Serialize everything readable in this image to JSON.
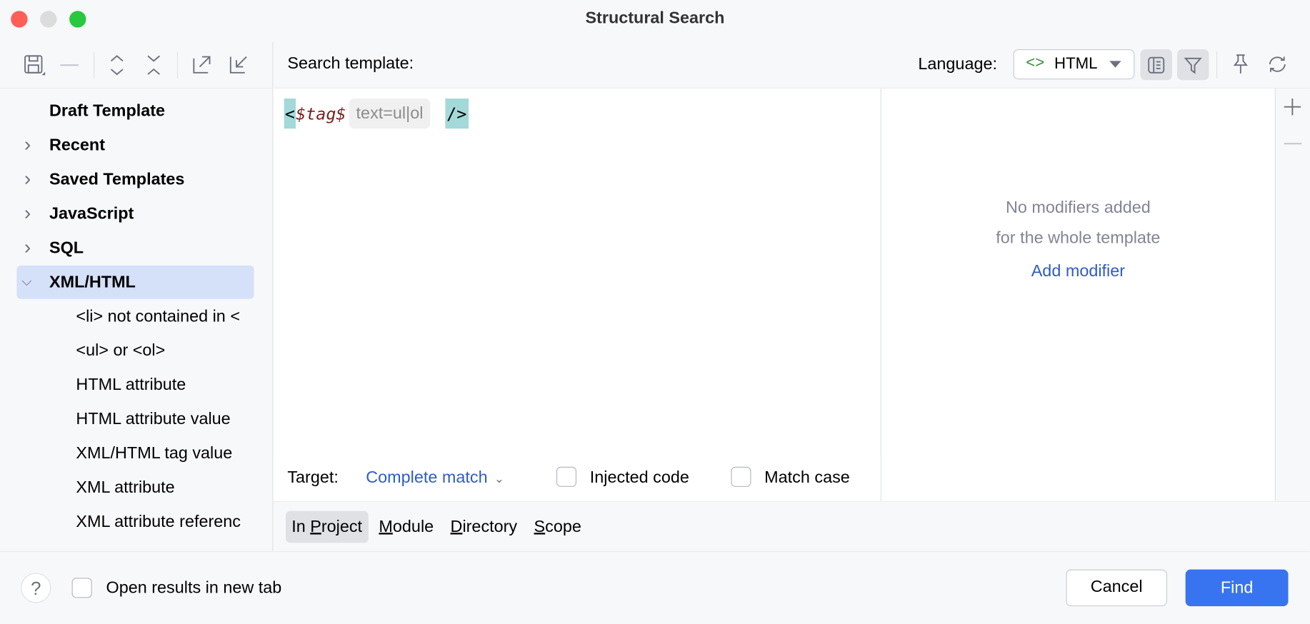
{
  "window": {
    "title": "Structural Search"
  },
  "sidebar": {
    "toolbar_icons": [
      "save-icon",
      "remove-icon",
      "expand-all-icon",
      "collapse-all-icon",
      "export-icon",
      "import-icon"
    ],
    "items": [
      {
        "label": "Draft Template",
        "level": 0,
        "expandable": false
      },
      {
        "label": "Recent",
        "level": 0,
        "expandable": true,
        "expanded": false
      },
      {
        "label": "Saved Templates",
        "level": 0,
        "expandable": true,
        "expanded": false
      },
      {
        "label": "JavaScript",
        "level": 0,
        "expandable": true,
        "expanded": false
      },
      {
        "label": "SQL",
        "level": 0,
        "expandable": true,
        "expanded": false
      },
      {
        "label": "XML/HTML",
        "level": 0,
        "expandable": true,
        "expanded": true,
        "selected": true
      },
      {
        "label": "<li> not contained in <",
        "level": 1
      },
      {
        "label": "<ul> or <ol>",
        "level": 1
      },
      {
        "label": "HTML attribute",
        "level": 1
      },
      {
        "label": "HTML attribute value",
        "level": 1
      },
      {
        "label": "XML/HTML tag value",
        "level": 1
      },
      {
        "label": "XML attribute",
        "level": 1
      },
      {
        "label": "XML attribute referenc",
        "level": 1
      }
    ]
  },
  "header": {
    "search_template_label": "Search template:",
    "language_label": "Language:",
    "language_value": "HTML"
  },
  "editor": {
    "open": "<",
    "variable": "$tag$",
    "inlay_hint": "text=ul|ol",
    "close": "/>"
  },
  "modifiers": {
    "empty_line1": "No modifiers added",
    "empty_line2": "for the whole template",
    "add_link": "Add modifier"
  },
  "options": {
    "target_label": "Target:",
    "target_value": "Complete match",
    "injected_code_label": "Injected code",
    "injected_code_checked": false,
    "match_case_label": "Match case",
    "match_case_checked": false
  },
  "scope": {
    "tabs": [
      {
        "pre": "In ",
        "mn": "P",
        "post": "roject",
        "selected": true
      },
      {
        "pre": "",
        "mn": "M",
        "post": "odule"
      },
      {
        "pre": "",
        "mn": "D",
        "post": "irectory"
      },
      {
        "pre": "",
        "mn": "S",
        "post": "cope"
      }
    ]
  },
  "footer": {
    "help": "?",
    "open_new_tab_label": "Open results in new tab",
    "open_new_tab_checked": false,
    "cancel": "Cancel",
    "find": "Find"
  },
  "colors": {
    "accent": "#3874f0",
    "link": "#2f5cc4",
    "selection": "#d5e0f9",
    "variable": "#871094"
  }
}
